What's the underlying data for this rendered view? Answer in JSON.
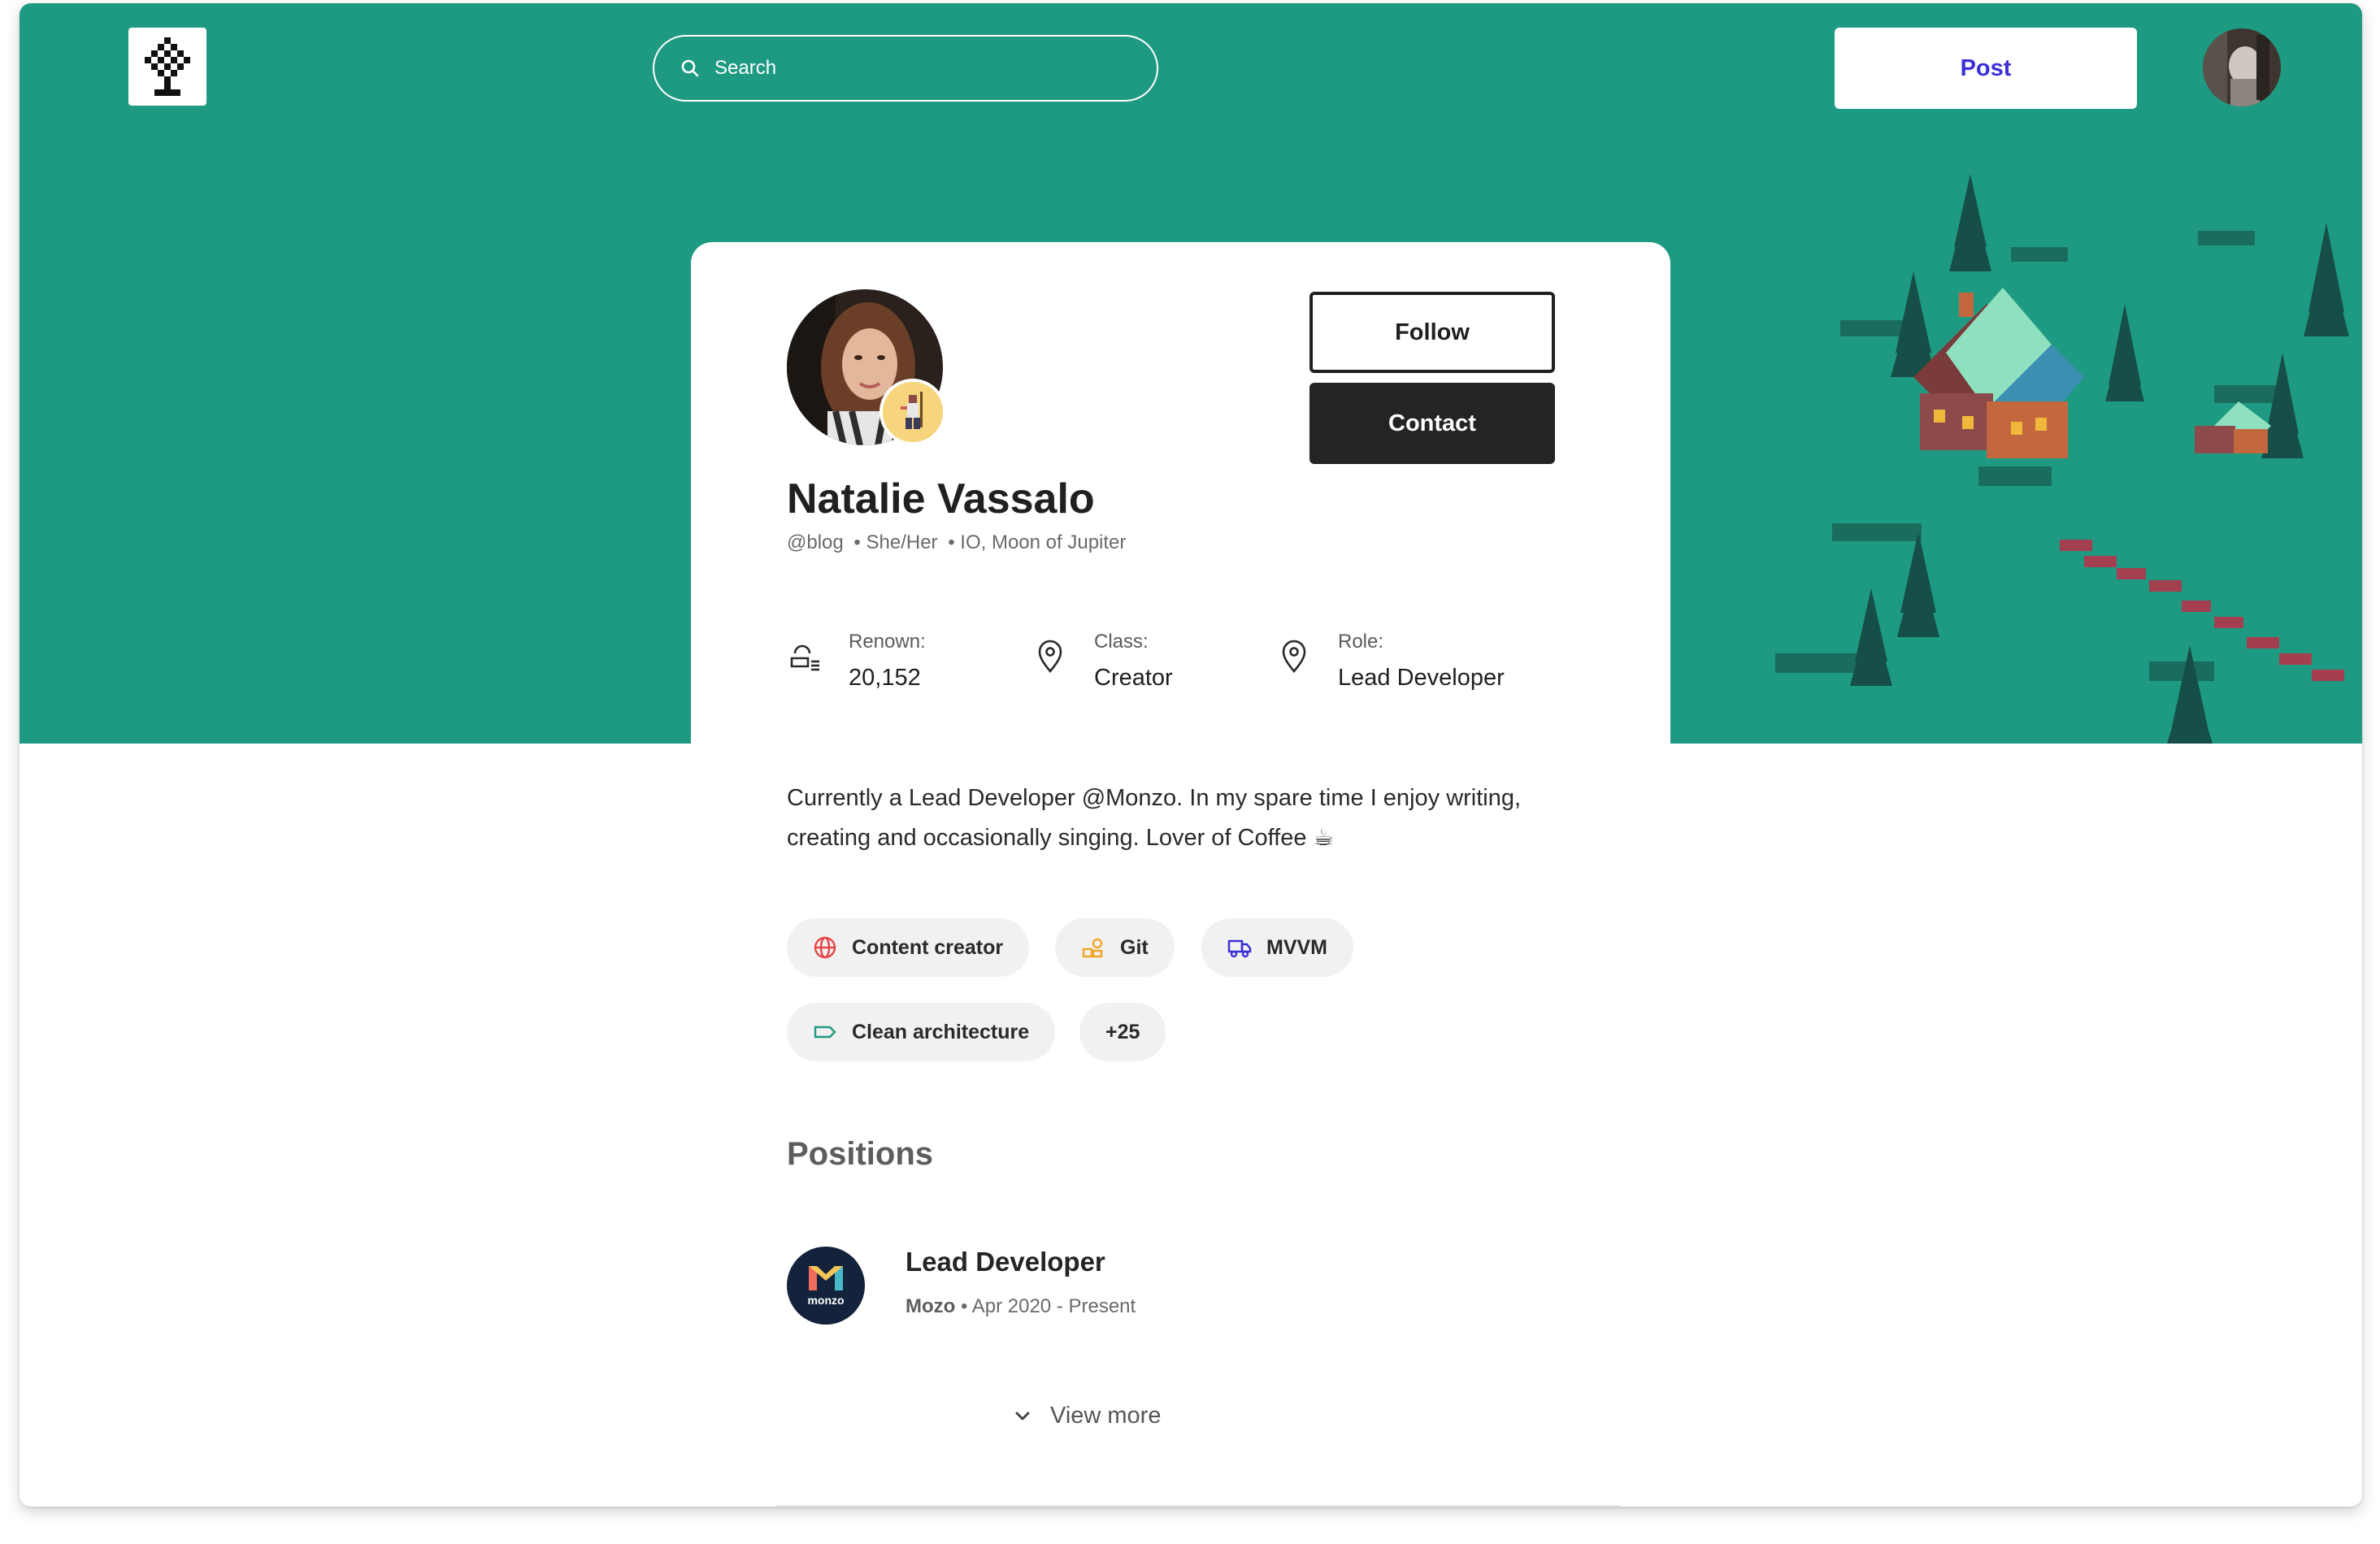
{
  "nav": {
    "search_placeholder": "Search",
    "post_label": "Post"
  },
  "profile": {
    "name": "Natalie Vassalo",
    "handle": "@blog",
    "pronouns": "• She/Her",
    "location": "• IO, Moon of Jupiter",
    "follow_label": "Follow",
    "contact_label": "Contact"
  },
  "stats": [
    {
      "label": "Renown:",
      "value": "20,152",
      "icon": "coins-icon"
    },
    {
      "label": "Class:",
      "value": "Creator",
      "icon": "location-pin-icon"
    },
    {
      "label": "Role:",
      "value": "Lead Developer",
      "icon": "location-pin-icon"
    }
  ],
  "bio": "Currently a Lead Developer @Monzo. In my spare time I enjoy writing, creating and occasionally singing. Lover of Coffee ☕",
  "tags": [
    {
      "label": "Content creator",
      "icon": "globe-icon",
      "color": "#e84545"
    },
    {
      "label": "Git",
      "icon": "coins-icon",
      "color": "#f0a526"
    },
    {
      "label": "MVVM",
      "icon": "truck-icon",
      "color": "#3b2fd6"
    },
    {
      "label": "Clean architecture",
      "icon": "tag-icon",
      "color": "#1f9a82"
    },
    {
      "label": "+25"
    }
  ],
  "positions": {
    "title": "Positions",
    "items": [
      {
        "title": "Lead Developer",
        "company": "Mozo",
        "period": "• Apr 2020 - Present",
        "logo_text": "monzo"
      }
    ]
  },
  "view_more_label": "View more",
  "colors": {
    "hero": "#1f9a82",
    "accent": "#3b2fd6",
    "dark_button": "#242424"
  }
}
